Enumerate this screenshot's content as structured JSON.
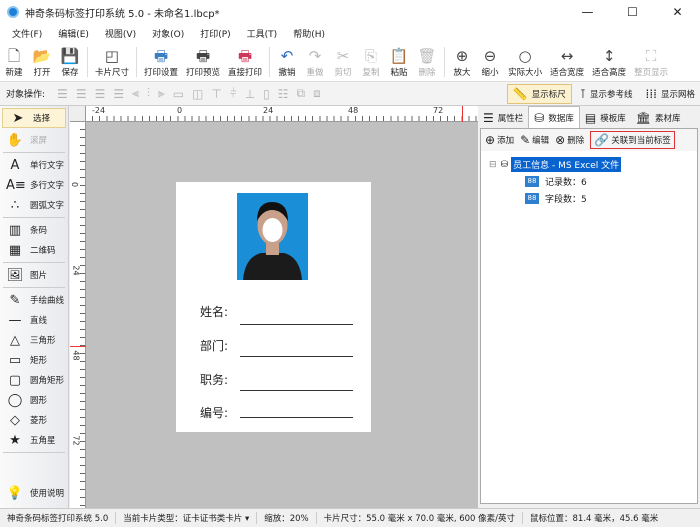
{
  "window": {
    "title": "神奇条码标签打印系统 5.0 - 未命名1.lbcp*",
    "minimize": "—",
    "maximize": "☐",
    "close": "✕"
  },
  "menu": [
    "文件(F)",
    "编辑(E)",
    "视图(V)",
    "对象(O)",
    "打印(P)",
    "工具(T)",
    "帮助(H)"
  ],
  "toolbar": [
    {
      "label": "新建",
      "icon": "new-file-icon",
      "glyph": "🗋"
    },
    {
      "label": "打开",
      "icon": "open-icon",
      "glyph": "📂"
    },
    {
      "label": "保存",
      "icon": "save-icon",
      "glyph": "💾"
    },
    {
      "label": "卡片尺寸",
      "icon": "card-size-icon",
      "glyph": "◰"
    },
    {
      "label": "打印设置",
      "icon": "print-settings-icon",
      "glyph": "🖶"
    },
    {
      "label": "打印预览",
      "icon": "print-preview-icon",
      "glyph": "🖶"
    },
    {
      "label": "直接打印",
      "icon": "print-icon",
      "glyph": "🖶"
    },
    {
      "label": "撤销",
      "icon": "undo-icon",
      "glyph": "↶"
    },
    {
      "label": "重做",
      "icon": "redo-icon",
      "glyph": "↷",
      "disabled": true
    },
    {
      "label": "剪切",
      "icon": "cut-icon",
      "glyph": "✂",
      "disabled": true
    },
    {
      "label": "复制",
      "icon": "copy-icon",
      "glyph": "⎘",
      "disabled": true
    },
    {
      "label": "粘贴",
      "icon": "paste-icon",
      "glyph": "📋"
    },
    {
      "label": "删除",
      "icon": "delete-icon",
      "glyph": "🗑",
      "disabled": true
    },
    {
      "label": "放大",
      "icon": "zoom-in-icon",
      "glyph": "⊕"
    },
    {
      "label": "缩小",
      "icon": "zoom-out-icon",
      "glyph": "⊖"
    },
    {
      "label": "实际大小",
      "icon": "actual-size-icon",
      "glyph": "○"
    },
    {
      "label": "适合宽度",
      "icon": "fit-width-icon",
      "glyph": "↔"
    },
    {
      "label": "适合高度",
      "icon": "fit-height-icon",
      "glyph": "↕"
    },
    {
      "label": "整页显示",
      "icon": "fit-page-icon",
      "glyph": "⛶",
      "disabled": true
    }
  ],
  "objbar": {
    "label": "对象操作:",
    "show_ruler": "显示标尺",
    "show_guides": "显示参考线",
    "show_grid": "显示网格"
  },
  "tools": [
    {
      "label": "选择",
      "glyph": "➤",
      "icon": "select-arrow-icon"
    },
    {
      "label": "滚屏",
      "glyph": "✋",
      "icon": "hand-icon"
    },
    {
      "label": "单行文字",
      "glyph": "A",
      "icon": "single-line-text-icon"
    },
    {
      "label": "多行文字",
      "glyph": "A≡",
      "icon": "multi-line-text-icon"
    },
    {
      "label": "圆弧文字",
      "glyph": "∴",
      "icon": "arc-text-icon"
    },
    {
      "label": "条码",
      "glyph": "▥",
      "icon": "barcode-icon"
    },
    {
      "label": "二维码",
      "glyph": "▦",
      "icon": "qrcode-icon"
    },
    {
      "label": "图片",
      "glyph": "🖼",
      "icon": "image-icon"
    },
    {
      "label": "手绘曲线",
      "glyph": "✎",
      "icon": "freehand-icon"
    },
    {
      "label": "直线",
      "glyph": "—",
      "icon": "line-icon"
    },
    {
      "label": "三角形",
      "glyph": "△",
      "icon": "triangle-icon"
    },
    {
      "label": "矩形",
      "glyph": "▭",
      "icon": "rectangle-icon"
    },
    {
      "label": "圆角矩形",
      "glyph": "▢",
      "icon": "rounded-rect-icon"
    },
    {
      "label": "圆形",
      "glyph": "◯",
      "icon": "ellipse-icon"
    },
    {
      "label": "菱形",
      "glyph": "◇",
      "icon": "diamond-icon"
    },
    {
      "label": "五角星",
      "glyph": "★",
      "icon": "star-icon"
    },
    {
      "label": "使用说明",
      "glyph": "💡",
      "icon": "help-bulb-icon"
    }
  ],
  "ruler": {
    "h": [
      "-24",
      "0",
      "24",
      "48",
      "72"
    ],
    "v": [
      "0",
      "24",
      "48",
      "72"
    ]
  },
  "card": {
    "fields": [
      "姓名:",
      "部门:",
      "职务:",
      "编号:"
    ]
  },
  "panel": {
    "tabs": [
      "属性栏",
      "数据库",
      "模板库",
      "素材库"
    ],
    "actions": {
      "add": "添加",
      "edit": "编辑",
      "delete": "删除",
      "link": "关联到当前标签"
    },
    "tree": {
      "root": "员工信息 - MS Excel 文件",
      "records": "记录数：6",
      "fields": "字段数：5",
      "expander": "⊟"
    }
  },
  "status": {
    "app": "神奇条码标签打印系统 5.0",
    "card_type": "当前卡片类型：证卡证书类卡片 ▾",
    "zoom": "缩放：20%",
    "card_size": "卡片尺寸：55.0 毫米 x 70.0 毫米, 600 像素/英寸",
    "mouse": "鼠标位置：81.4 毫米，45.6 毫米"
  }
}
